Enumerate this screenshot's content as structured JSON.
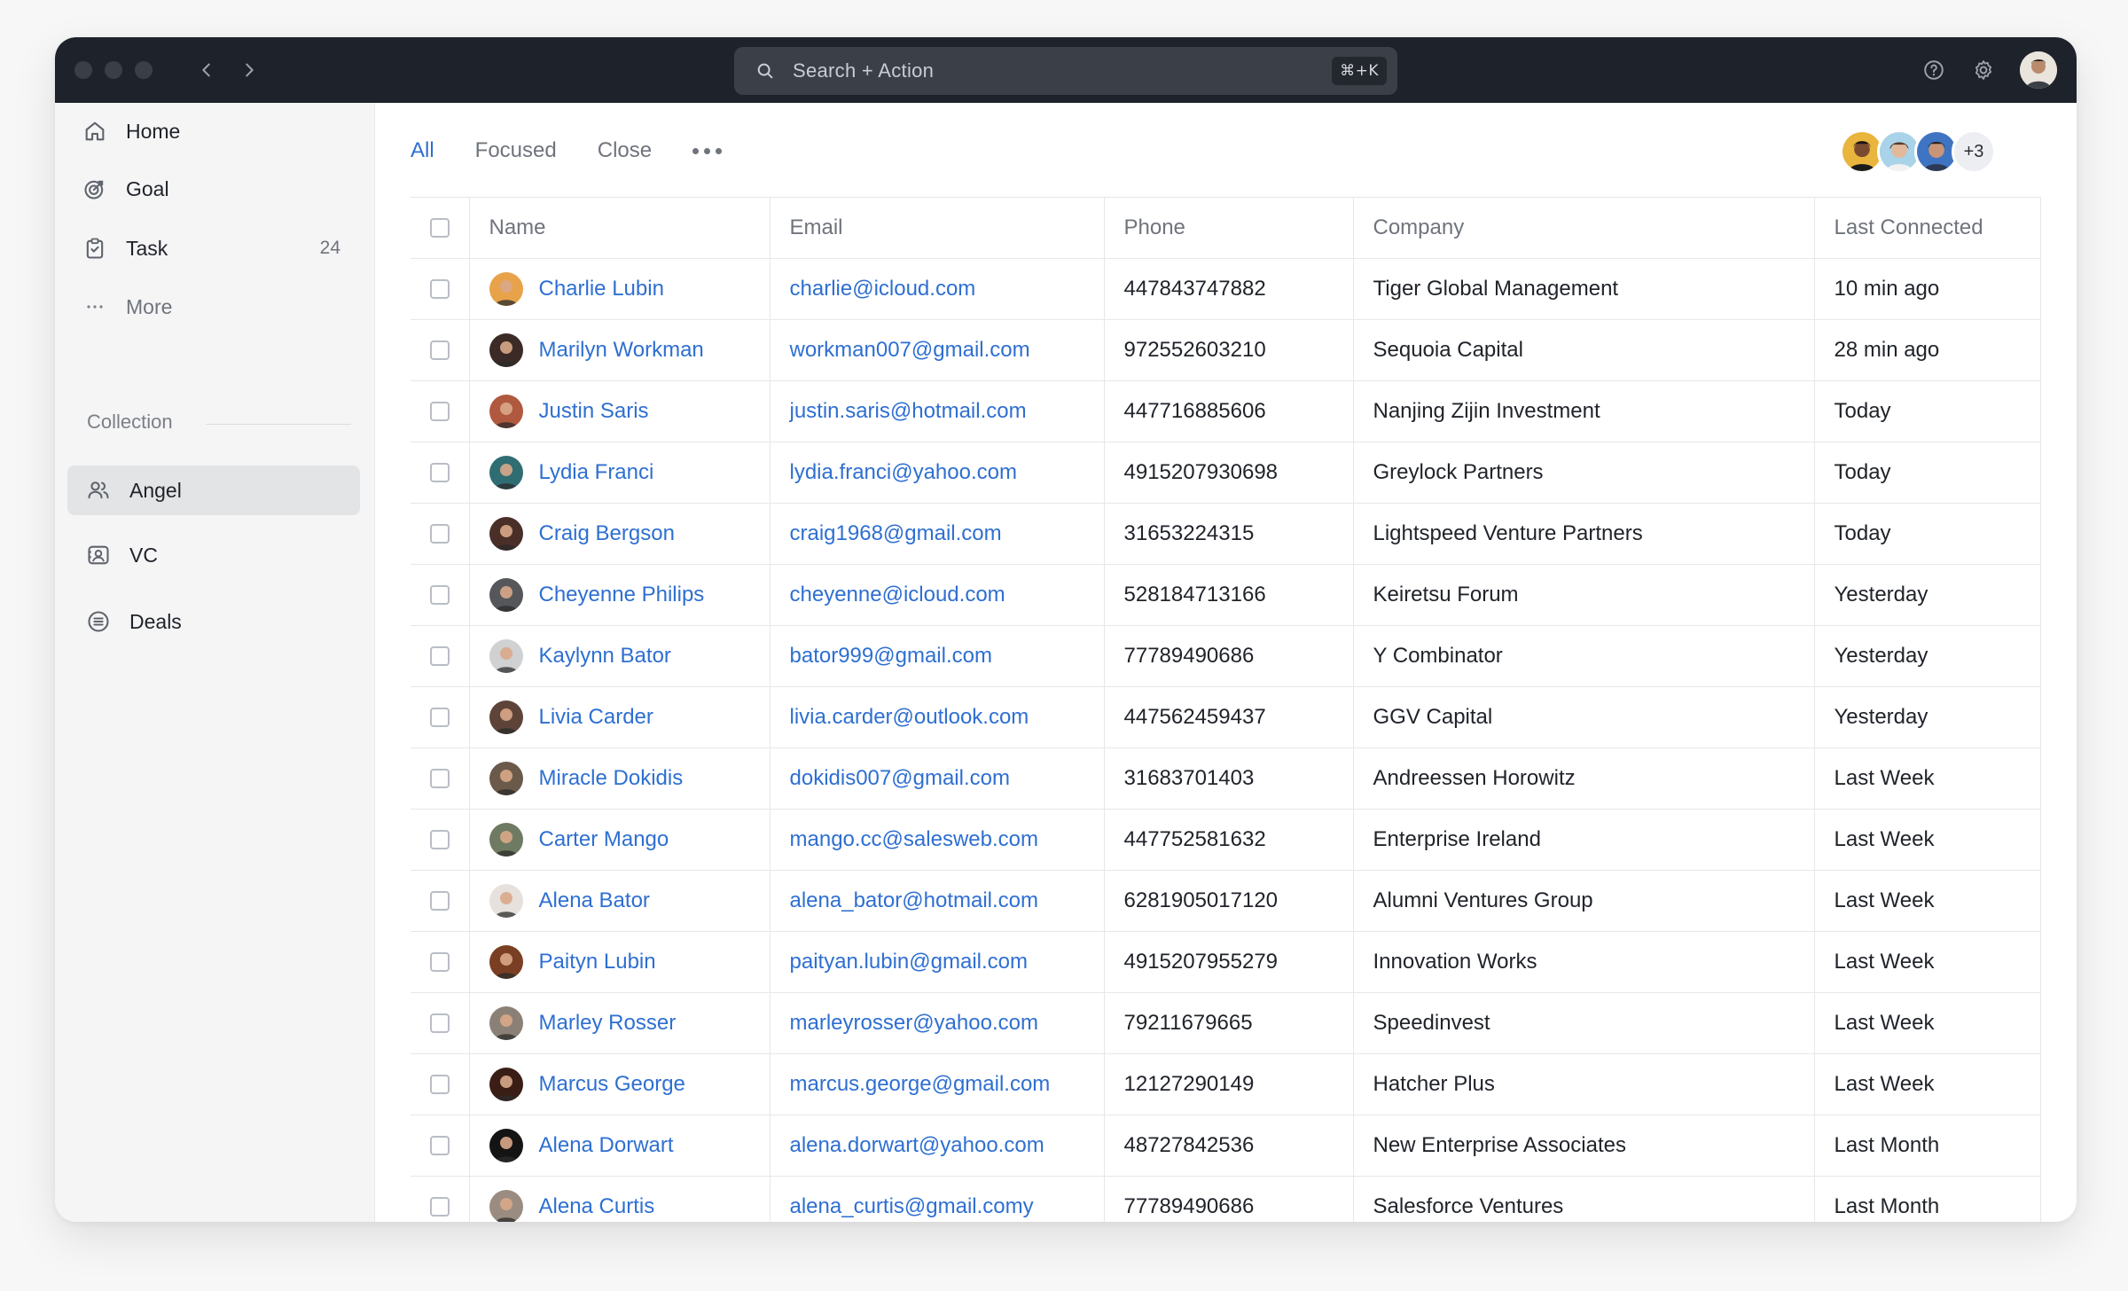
{
  "titlebar": {
    "search_placeholder": "Search + Action",
    "shortcut": "⌘+K",
    "icons": [
      "chevron-left-icon",
      "chevron-right-icon",
      "search-icon",
      "help-icon",
      "gear-icon"
    ]
  },
  "sidebar": {
    "items": [
      {
        "label": "Home",
        "icon": "home-icon"
      },
      {
        "label": "Goal",
        "icon": "goal-icon"
      },
      {
        "label": "Task",
        "icon": "task-icon",
        "count": "24"
      },
      {
        "label": "More",
        "icon": "ellipsis-icon"
      }
    ],
    "collection_label": "Collection",
    "collection_items": [
      {
        "label": "Angel",
        "icon": "people-icon",
        "active": true
      },
      {
        "label": "VC",
        "icon": "contact-card-icon"
      },
      {
        "label": "Deals",
        "icon": "list-circle-icon"
      }
    ]
  },
  "main": {
    "tabs": [
      {
        "label": "All",
        "active": true
      },
      {
        "label": "Focused"
      },
      {
        "label": "Close"
      }
    ],
    "extra_members": "+3",
    "columns": [
      "Name",
      "Email",
      "Phone",
      "Company",
      "Last Connected"
    ],
    "rows": [
      {
        "name": "Charlie Lubin",
        "email": "charlie@icloud.com",
        "phone": "447843747882",
        "company": "Tiger Global Management",
        "last": "10 min ago",
        "avatar": "#e8a24a"
      },
      {
        "name": "Marilyn Workman",
        "email": "workman007@gmail.com",
        "phone": "972552603210",
        "company": "Sequoia Capital",
        "last": "28 min ago",
        "avatar": "#3b2a25"
      },
      {
        "name": "Justin Saris",
        "email": "justin.saris@hotmail.com",
        "phone": "447716885606",
        "company": "Nanjing Zijin Investment",
        "last": "Today",
        "avatar": "#b0593f"
      },
      {
        "name": "Lydia Franci",
        "email": "lydia.franci@yahoo.com",
        "phone": "4915207930698",
        "company": "Greylock Partners",
        "last": "Today",
        "avatar": "#2f6d73"
      },
      {
        "name": "Craig Bergson",
        "email": "craig1968@gmail.com",
        "phone": "31653224315",
        "company": "Lightspeed Venture Partners",
        "last": "Today",
        "avatar": "#4a2f28"
      },
      {
        "name": "Cheyenne Philips",
        "email": "cheyenne@icloud.com",
        "phone": "528184713166",
        "company": "Keiretsu Forum",
        "last": "Yesterday",
        "avatar": "#55575a"
      },
      {
        "name": "Kaylynn Bator",
        "email": "bator999@gmail.com",
        "phone": "77789490686",
        "company": "Y Combinator",
        "last": "Yesterday",
        "avatar": "#cfd1d3"
      },
      {
        "name": "Livia Carder",
        "email": "livia.carder@outlook.com",
        "phone": "447562459437",
        "company": "GGV Capital",
        "last": "Yesterday",
        "avatar": "#5e4438"
      },
      {
        "name": "Miracle Dokidis",
        "email": "dokidis007@gmail.com",
        "phone": "31683701403",
        "company": "Andreessen Horowitz",
        "last": "Last Week",
        "avatar": "#6b5a4a"
      },
      {
        "name": "Carter Mango",
        "email": "mango.cc@salesweb.com",
        "phone": "447752581632",
        "company": "Enterprise Ireland",
        "last": "Last Week",
        "avatar": "#6e7b62"
      },
      {
        "name": "Alena Bator",
        "email": "alena_bator@hotmail.com",
        "phone": "6281905017120",
        "company": "Alumni Ventures Group",
        "last": "Last Week",
        "avatar": "#e6e1dc"
      },
      {
        "name": "Paityn Lubin",
        "email": "paityan.lubin@gmail.com",
        "phone": "4915207955279",
        "company": "Innovation Works",
        "last": "Last Week",
        "avatar": "#7a3f22"
      },
      {
        "name": "Marley Rosser",
        "email": "marleyrosser@yahoo.com",
        "phone": "79211679665",
        "company": "Speedinvest",
        "last": "Last Week",
        "avatar": "#8a8076"
      },
      {
        "name": "Marcus George",
        "email": "marcus.george@gmail.com",
        "phone": "12127290149",
        "company": "Hatcher Plus",
        "last": "Last Week",
        "avatar": "#3a1e15"
      },
      {
        "name": "Alena Dorwart",
        "email": "alena.dorwart@yahoo.com",
        "phone": "48727842536",
        "company": "New Enterprise Associates",
        "last": "Last Month",
        "avatar": "#141414"
      },
      {
        "name": "Alena Curtis",
        "email": "alena_curtis@gmail.comy",
        "phone": "77789490686",
        "company": "Salesforce Ventures",
        "last": "Last Month",
        "avatar": "#9a8c80"
      }
    ]
  }
}
